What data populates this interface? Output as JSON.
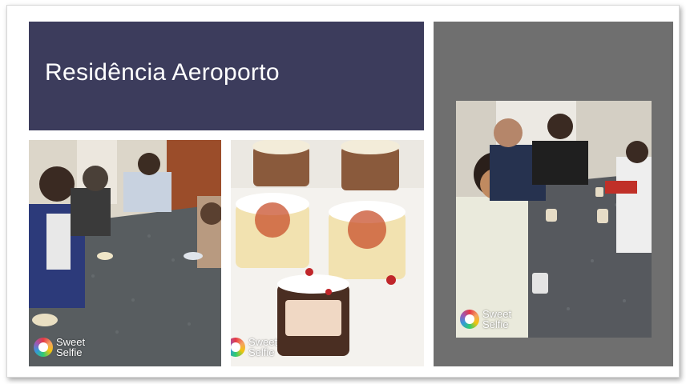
{
  "slide": {
    "title": "Residência Aeroporto",
    "title_bg": "#3c3c5c",
    "side_panel_bg": "#6f6f6f"
  },
  "photos": [
    {
      "subject": "residents-eating-at-table",
      "watermark_line1": "Sweet",
      "watermark_line2": "Selfie"
    },
    {
      "subject": "dessert-cups-on-table",
      "watermark_line1": "Sweet",
      "watermark_line2": "Selfie"
    },
    {
      "subject": "residents-eating-at-table-2",
      "watermark_line1": "Sweet",
      "watermark_line2": "Selfie"
    }
  ]
}
